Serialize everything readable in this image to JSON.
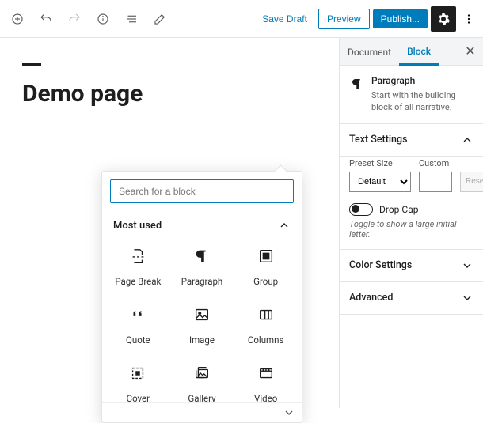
{
  "topbar": {
    "save_draft_label": "Save Draft",
    "preview_label": "Preview",
    "publish_label": "Publish..."
  },
  "editor": {
    "page_title": "Demo page"
  },
  "inserter": {
    "search_placeholder": "Search for a block",
    "section_label": "Most used",
    "blocks": [
      {
        "label": "Page Break",
        "icon": "page-break"
      },
      {
        "label": "Paragraph",
        "icon": "paragraph"
      },
      {
        "label": "Group",
        "icon": "group"
      },
      {
        "label": "Quote",
        "icon": "quote"
      },
      {
        "label": "Image",
        "icon": "image"
      },
      {
        "label": "Columns",
        "icon": "columns"
      },
      {
        "label": "Cover",
        "icon": "cover"
      },
      {
        "label": "Gallery",
        "icon": "gallery"
      },
      {
        "label": "Video",
        "icon": "video"
      }
    ]
  },
  "sidebar": {
    "tabs": {
      "document": "Document",
      "block": "Block"
    },
    "block_card": {
      "title": "Paragraph",
      "desc": "Start with the building block of all narrative."
    },
    "panels": {
      "text_settings": {
        "title": "Text Settings",
        "preset_label": "Preset Size",
        "preset_value": "Default",
        "custom_label": "Custom",
        "reset_label": "Reset",
        "dropcap_label": "Drop Cap",
        "dropcap_desc": "Toggle to show a large initial letter."
      },
      "color_settings": {
        "title": "Color Settings"
      },
      "advanced": {
        "title": "Advanced"
      }
    }
  }
}
